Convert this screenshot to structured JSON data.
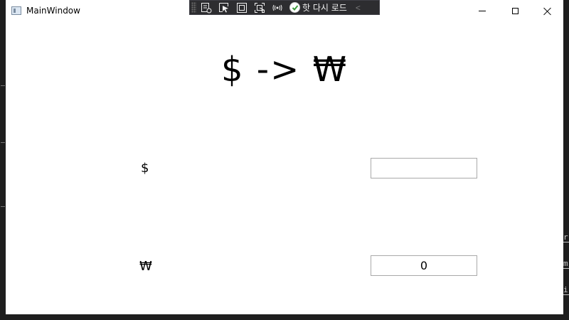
{
  "window": {
    "title": "MainWindow"
  },
  "debug_toolbar": {
    "buttons": [
      {
        "icon": "live-visual-tree-icon"
      },
      {
        "icon": "select-element-icon"
      },
      {
        "icon": "display-layout-adorners-icon"
      },
      {
        "icon": "track-focused-element-icon"
      },
      {
        "icon": "accessibility-check-icon"
      }
    ],
    "hot_reload_label": "핫 다시 로드",
    "collapse_glyph": "<"
  },
  "main": {
    "heading": "$ -> ₩",
    "usd": {
      "label": "$",
      "value": ""
    },
    "krw": {
      "label": "₩",
      "value": "0"
    }
  },
  "side_strip": {
    "chars": [
      "r",
      "m",
      "i"
    ]
  },
  "colors": {
    "toolbar_bg": "#2d2d30",
    "window_bg": "#ffffff",
    "field_border": "#a9a9a9"
  }
}
